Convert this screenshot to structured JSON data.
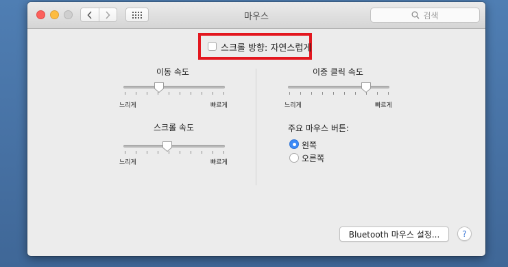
{
  "window": {
    "title": "마우스"
  },
  "search": {
    "placeholder": "검색"
  },
  "natural_scroll": {
    "label": "스크롤 방향: 자연스럽게",
    "checked": false
  },
  "tracking_speed": {
    "title": "이동 속도",
    "min_label": "느리게",
    "max_label": "빠르게",
    "value": 0.35
  },
  "double_click_speed": {
    "title": "이중 클릭 속도",
    "min_label": "느리게",
    "max_label": "빠르게",
    "value": 0.77
  },
  "scroll_speed": {
    "title": "스크롤 속도",
    "min_label": "느리게",
    "max_label": "빠르게",
    "value": 0.43
  },
  "primary_button": {
    "title": "주요 마우스 버튼:",
    "options": [
      {
        "label": "왼쪽",
        "selected": true
      },
      {
        "label": "오른쪽",
        "selected": false
      }
    ]
  },
  "footer": {
    "bluetooth_button": "Bluetooth 마우스 설정...",
    "help_label": "?"
  },
  "colors": {
    "highlight": "#e3171f",
    "accent": "#3c8af7",
    "window_bg": "#ececec",
    "desktop": "#4a76a8"
  },
  "icons": [
    "back-icon",
    "forward-icon",
    "grid-icon",
    "search-icon",
    "arrow-annotation"
  ]
}
